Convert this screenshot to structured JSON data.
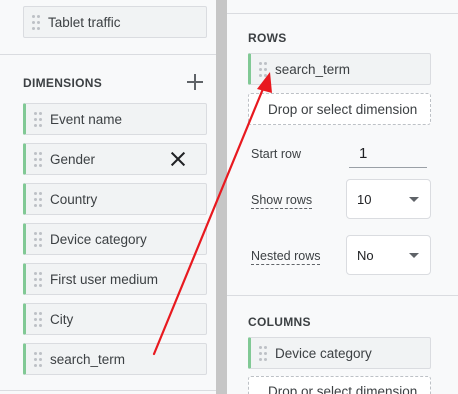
{
  "left": {
    "metric_chip": "Tablet traffic",
    "dimensions_title": "DIMENSIONS",
    "dimensions": [
      "Event name",
      "Gender",
      "Country",
      "Device category",
      "First user medium",
      "City",
      "search_term"
    ]
  },
  "right": {
    "rows_title": "ROWS",
    "row_chip": "search_term",
    "drop_label": "Drop or select dimension",
    "start_row_label": "Start row",
    "start_row_value": "1",
    "show_rows_label": "Show rows",
    "show_rows_value": "10",
    "nested_rows_label": "Nested rows",
    "nested_rows_value": "No",
    "columns_title": "COLUMNS",
    "column_chip": "Device category",
    "drop_label_2": "Drop or select dimension"
  },
  "colors": {
    "dimension_accent": "#81c995",
    "arrow": "#e8191f"
  }
}
